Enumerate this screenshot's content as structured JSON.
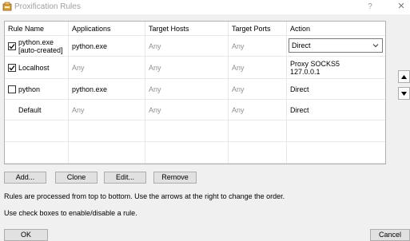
{
  "window": {
    "title": "Proxification Rules",
    "help_glyph": "?",
    "close_glyph": "✕"
  },
  "table": {
    "columns": [
      "Rule Name",
      "Applications",
      "Target Hosts",
      "Target Ports",
      "Action"
    ],
    "rows": [
      {
        "checked": true,
        "name_line1": "python.exe",
        "name_line2": "[auto-created]",
        "applications": "python.exe",
        "target_hosts": "Any",
        "target_ports": "Any",
        "action": "Direct",
        "selected": true
      },
      {
        "checked": true,
        "name": "Localhost",
        "applications": "Any",
        "target_hosts": "Any",
        "target_ports": "Any",
        "action_line1": "Proxy SOCKS5",
        "action_line2": "127.0.0.1"
      },
      {
        "checked": false,
        "name": "python",
        "applications": "python.exe",
        "target_hosts": "Any",
        "target_ports": "Any",
        "action": "Direct"
      },
      {
        "checkbox": false,
        "name": "Default",
        "applications": "Any",
        "target_hosts": "Any",
        "target_ports": "Any",
        "action": "Direct"
      }
    ]
  },
  "side_buttons": {
    "up_icon": "arrow-up",
    "down_icon": "arrow-down"
  },
  "buttons": {
    "add": "Add...",
    "clone": "Clone",
    "edit": "Edit...",
    "remove": "Remove"
  },
  "info": {
    "line1": "Rules are processed from top to bottom. Use the arrows at the right to change the order.",
    "line2": "Use check boxes to enable/disable a rule."
  },
  "footer": {
    "ok": "OK",
    "cancel": "Cancel"
  },
  "colors": {
    "disabled_text": "#909090",
    "title_text": "#a0a0a0"
  }
}
